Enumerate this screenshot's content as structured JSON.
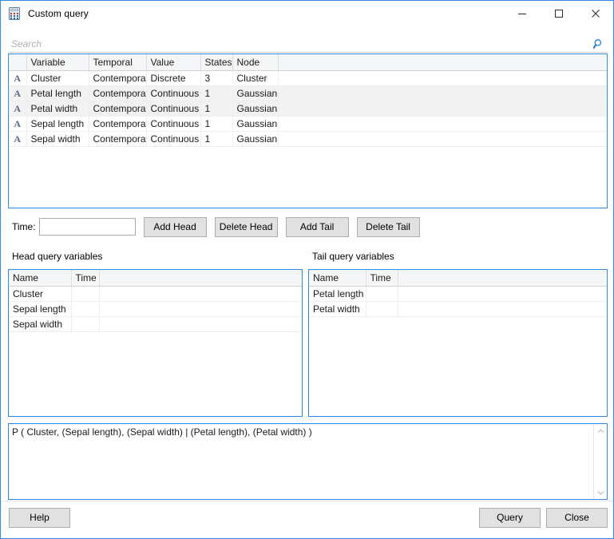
{
  "window": {
    "title": "Custom query",
    "icon": "calculator-icon",
    "accent_color": "#2d8ceb",
    "controls": {
      "minimize": "minimize-icon",
      "maximize": "maximize-icon",
      "close": "close-icon"
    }
  },
  "search": {
    "placeholder": "Search",
    "value": "",
    "icon": "search-icon"
  },
  "variable_grid": {
    "columns": [
      "",
      "Variable",
      "Temporal",
      "Value",
      "States",
      "Node",
      ""
    ],
    "rows": [
      {
        "icon": "A",
        "variable": "Cluster",
        "temporal": "Contemporal",
        "value": "Discrete",
        "states": "3",
        "node": "Cluster",
        "selected": false
      },
      {
        "icon": "A",
        "variable": "Petal length",
        "temporal": "Contemporal",
        "value": "Continuous",
        "states": "1",
        "node": "Gaussian",
        "selected": true
      },
      {
        "icon": "A",
        "variable": "Petal width",
        "temporal": "Contemporal",
        "value": "Continuous",
        "states": "1",
        "node": "Gaussian",
        "selected": true
      },
      {
        "icon": "A",
        "variable": "Sepal length",
        "temporal": "Contemporal",
        "value": "Continuous",
        "states": "1",
        "node": "Gaussian",
        "selected": false
      },
      {
        "icon": "A",
        "variable": "Sepal width",
        "temporal": "Contemporal",
        "value": "Continuous",
        "states": "1",
        "node": "Gaussian",
        "selected": false
      }
    ]
  },
  "time_row": {
    "label": "Time:",
    "input_value": "",
    "buttons": {
      "add_head": "Add Head",
      "delete_head": "Delete Head",
      "add_tail": "Add Tail",
      "delete_tail": "Delete Tail"
    }
  },
  "head_section": {
    "label": "Head query variables",
    "columns": [
      "Name",
      "Time",
      ""
    ],
    "rows": [
      {
        "name": "Cluster",
        "time": ""
      },
      {
        "name": "Sepal length",
        "time": ""
      },
      {
        "name": "Sepal width",
        "time": ""
      }
    ]
  },
  "tail_section": {
    "label": "Tail query variables",
    "columns": [
      "Name",
      "Time",
      ""
    ],
    "rows": [
      {
        "name": "Petal length",
        "time": ""
      },
      {
        "name": "Petal width",
        "time": ""
      }
    ]
  },
  "expression": {
    "text": "P ( Cluster, (Sepal length), (Sepal width) | (Petal length), (Petal width) )"
  },
  "footer": {
    "help": "Help",
    "query": "Query",
    "close": "Close"
  }
}
